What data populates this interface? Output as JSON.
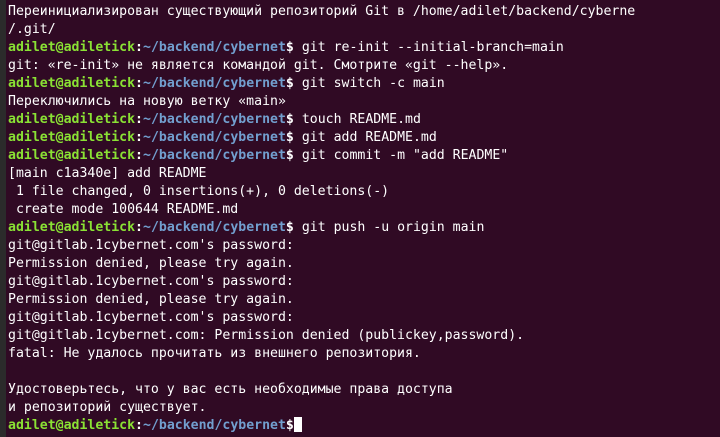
{
  "terminal": {
    "prompt": {
      "user_host": "adilet@adiletick",
      "colon": ":",
      "path": "~/backend/cybernet",
      "dollar": "$"
    },
    "lines": [
      {
        "type": "output",
        "text": "Переинициализирован существующий репозиторий Git в /home/adilet/backend/cyberne"
      },
      {
        "type": "output",
        "text": "/.git/"
      },
      {
        "type": "prompt",
        "text": " git re-init --initial-branch=main"
      },
      {
        "type": "output",
        "text": "git: «re-init» не является командой git. Смотрите «git --help»."
      },
      {
        "type": "prompt",
        "text": " git switch -c main"
      },
      {
        "type": "output",
        "text": "Переключились на новую ветку «main»"
      },
      {
        "type": "prompt",
        "text": " touch README.md"
      },
      {
        "type": "prompt",
        "text": " git add README.md"
      },
      {
        "type": "prompt",
        "text": " git commit -m \"add README\""
      },
      {
        "type": "output",
        "text": "[main c1a340e] add README"
      },
      {
        "type": "output",
        "text": " 1 file changed, 0 insertions(+), 0 deletions(-)"
      },
      {
        "type": "output",
        "text": " create mode 100644 README.md"
      },
      {
        "type": "prompt",
        "text": " git push -u origin main"
      },
      {
        "type": "output",
        "text": "git@gitlab.1cybernet.com's password:"
      },
      {
        "type": "output",
        "text": "Permission denied, please try again."
      },
      {
        "type": "output",
        "text": "git@gitlab.1cybernet.com's password:"
      },
      {
        "type": "output",
        "text": "Permission denied, please try again."
      },
      {
        "type": "output",
        "text": "git@gitlab.1cybernet.com's password:"
      },
      {
        "type": "output",
        "text": "git@gitlab.1cybernet.com: Permission denied (publickey,password)."
      },
      {
        "type": "output",
        "text": "fatal: Не удалось прочитать из внешнего репозитория."
      },
      {
        "type": "output",
        "text": ""
      },
      {
        "type": "output",
        "text": "Удостоверьтесь, что у вас есть необходимые права доступа"
      },
      {
        "type": "output",
        "text": "и репозиторий существует."
      },
      {
        "type": "prompt",
        "text": "",
        "cursor": true
      }
    ]
  },
  "colors": {
    "background": "#300a24",
    "user_host": "#8ae234",
    "path": "#729fcf",
    "text": "#ffffff"
  }
}
